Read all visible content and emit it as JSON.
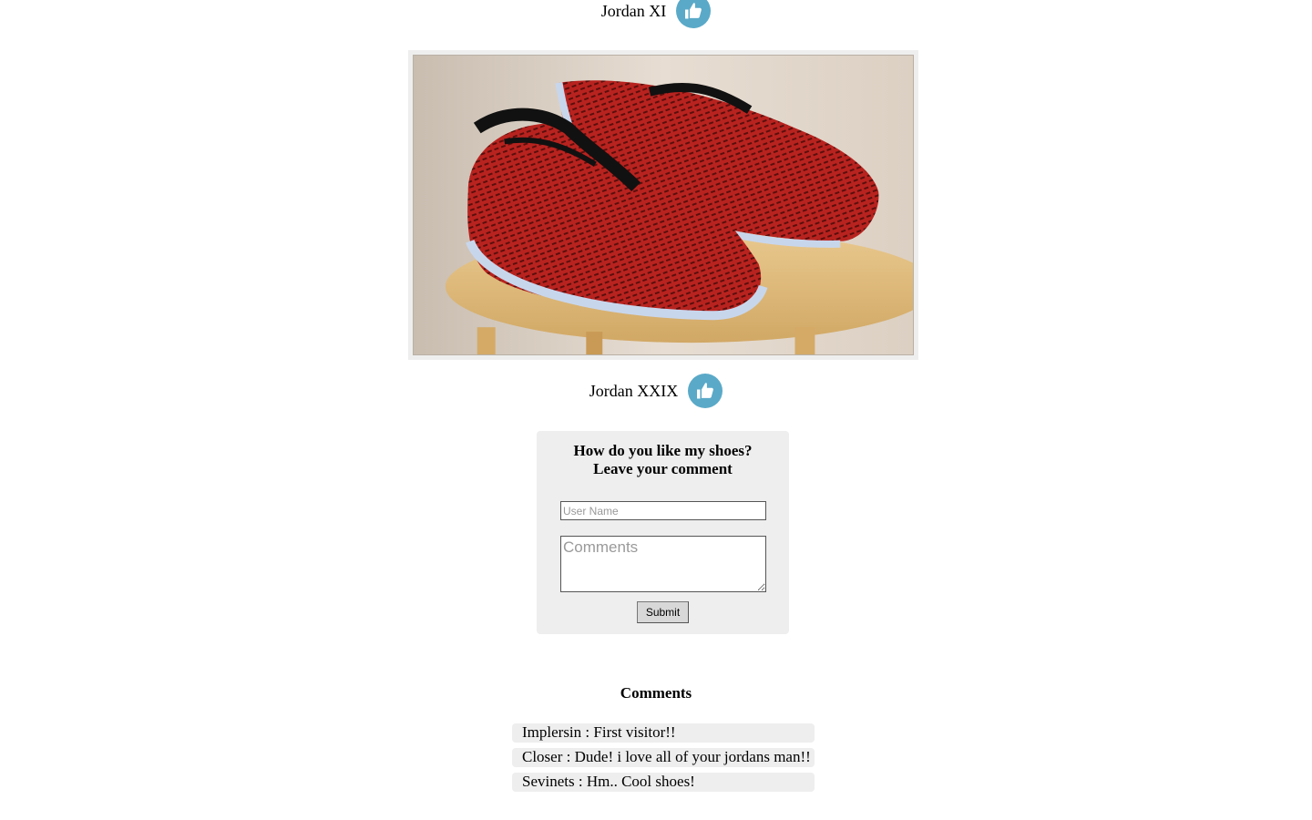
{
  "shoes": [
    {
      "name": "Jordan XI",
      "like_icon": "thumbs-up-icon"
    },
    {
      "name": "Jordan XXIX",
      "like_icon": "thumbs-up-icon"
    }
  ],
  "colors": {
    "like_button": "#5aa9c8",
    "panel_background": "#eeeeee",
    "shoe_red": "#c02a26"
  },
  "form": {
    "title_line1": "How do you like my shoes?",
    "title_line2": "Leave your comment",
    "username_placeholder": "User Name",
    "comments_placeholder": "Comments",
    "submit_label": "Submit"
  },
  "comments_section": {
    "heading": "Comments",
    "items": [
      {
        "user": "Implersin",
        "text": "First visitor!!"
      },
      {
        "user": "Closer",
        "text": "Dude! i love all of your jordans man!!"
      },
      {
        "user": "Sevinets",
        "text": "Hm.. Cool shoes!"
      }
    ]
  }
}
